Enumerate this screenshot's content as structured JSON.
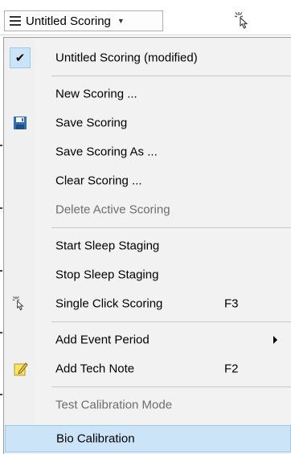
{
  "toolbar": {
    "scoring_selector_label": "Untitled Scoring",
    "scoring_selector_icon": "list-icon",
    "pointer_tool_icon": "click-pointer-icon"
  },
  "menu": {
    "items": [
      {
        "label": "Untitled Scoring (modified)",
        "checked": true,
        "disabled": false
      },
      {
        "label": "New Scoring ...",
        "disabled": false
      },
      {
        "label": "Save Scoring",
        "icon": "save-icon",
        "disabled": false
      },
      {
        "label": "Save Scoring As ...",
        "disabled": false
      },
      {
        "label": "Clear Scoring ...",
        "disabled": false
      },
      {
        "label": "Delete Active Scoring",
        "disabled": true
      },
      {
        "label": "Start Sleep Staging",
        "disabled": false
      },
      {
        "label": "Stop Sleep Staging",
        "disabled": false
      },
      {
        "label": "Single Click Scoring",
        "icon": "click-pointer-icon",
        "shortcut": "F3",
        "disabled": false
      },
      {
        "label": "Add Event Period",
        "has_submenu": true,
        "disabled": false
      },
      {
        "label": "Add Tech Note",
        "icon": "note-pencil-icon",
        "shortcut": "F2",
        "disabled": false
      },
      {
        "label": "Test Calibration Mode",
        "disabled": true
      },
      {
        "label": "Bio Calibration",
        "highlighted": true,
        "disabled": false
      }
    ]
  },
  "colors": {
    "highlight_bg": "#cce4f7",
    "highlight_border": "#99c9ef",
    "disabled_text": "#6d6d6d",
    "menu_bg": "#f2f2f2"
  }
}
